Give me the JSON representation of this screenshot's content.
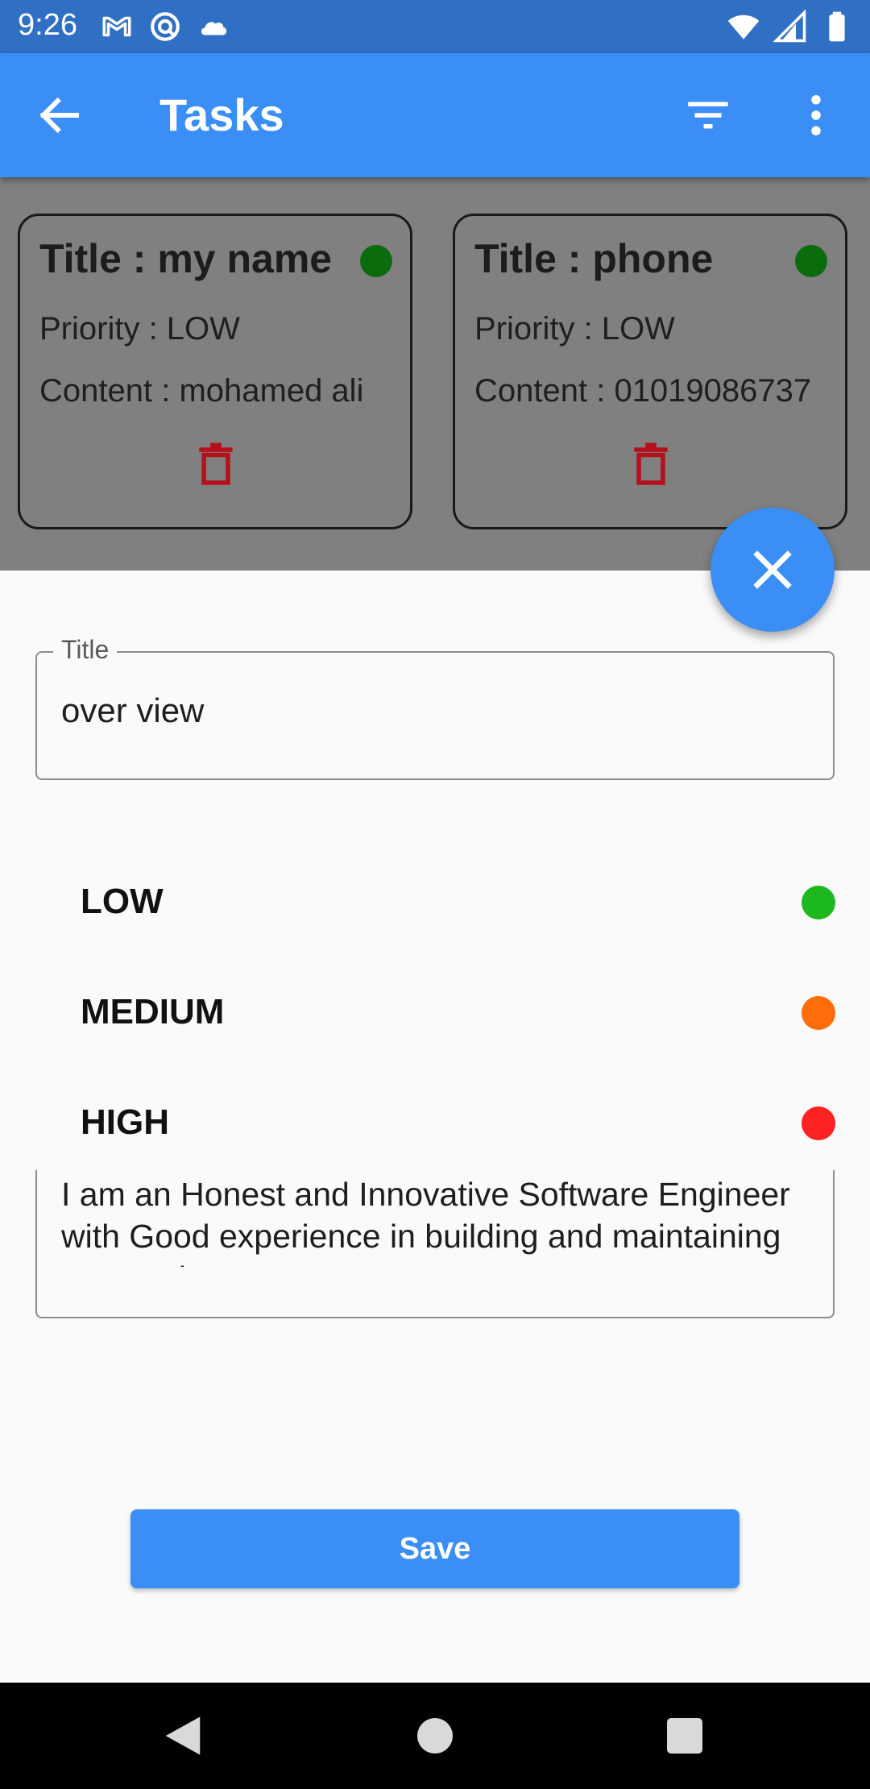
{
  "status_bar": {
    "time": "9:26",
    "left_icons": [
      "gmail-icon",
      "sync-icon",
      "cloud-icon"
    ],
    "right_icons": [
      "wifi-icon",
      "signal-icon",
      "battery-icon"
    ]
  },
  "app_bar": {
    "title": "Tasks",
    "back_icon": "arrow-back-icon",
    "filter_icon": "filter-icon",
    "more_icon": "more-vert-icon"
  },
  "tasks": [
    {
      "title": "Title : my name",
      "priority": "Priority : LOW",
      "content": "Content : mohamed ali",
      "status_color": "#0c6b0c"
    },
    {
      "title": "Title : phone",
      "priority": "Priority : LOW",
      "content": "Content : 01019086737",
      "status_color": "#0c6b0c"
    }
  ],
  "sheet": {
    "title_field": {
      "label": "Title",
      "value": "over view"
    },
    "priority_options": [
      {
        "label": "LOW",
        "color": "#1db81d"
      },
      {
        "label": "MEDIUM",
        "color": "#ff6d0a"
      },
      {
        "label": "HIGH",
        "color": "#ff2222"
      }
    ],
    "content_text": "I am an Honest and Innovative Software Engineer with Good experience in building and maintaining responsive",
    "save_label": "Save"
  },
  "colors": {
    "primary": "#3a8ef6",
    "status_bar": "#2f6fc4",
    "delete": "#b3121a"
  }
}
